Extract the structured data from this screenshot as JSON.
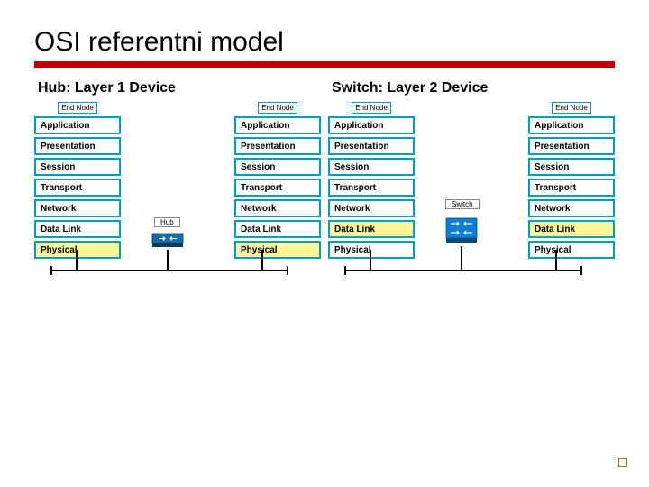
{
  "title": "OSI referentni model",
  "panels": [
    {
      "title": "Hub: Layer 1 Device",
      "device_label": "Hub",
      "device_type": "hub",
      "end_node_label": "End Node",
      "layers": [
        {
          "name": "Application",
          "highlight": false
        },
        {
          "name": "Presentation",
          "highlight": false
        },
        {
          "name": "Session",
          "highlight": false
        },
        {
          "name": "Transport",
          "highlight": false
        },
        {
          "name": "Network",
          "highlight": false
        },
        {
          "name": "Data Link",
          "highlight": false
        },
        {
          "name": "Physical",
          "highlight": true
        }
      ]
    },
    {
      "title": "Switch: Layer 2 Device",
      "device_label": "Switch",
      "device_type": "switch",
      "end_node_label": "End Node",
      "layers": [
        {
          "name": "Application",
          "highlight": false
        },
        {
          "name": "Presentation",
          "highlight": false
        },
        {
          "name": "Session",
          "highlight": false
        },
        {
          "name": "Transport",
          "highlight": false
        },
        {
          "name": "Network",
          "highlight": false
        },
        {
          "name": "Data Link",
          "highlight": true
        },
        {
          "name": "Physical",
          "highlight": false
        }
      ]
    }
  ],
  "colors": {
    "accent_red": "#c00000",
    "layer_border": "#009fc2",
    "highlight": "#fff59a"
  }
}
